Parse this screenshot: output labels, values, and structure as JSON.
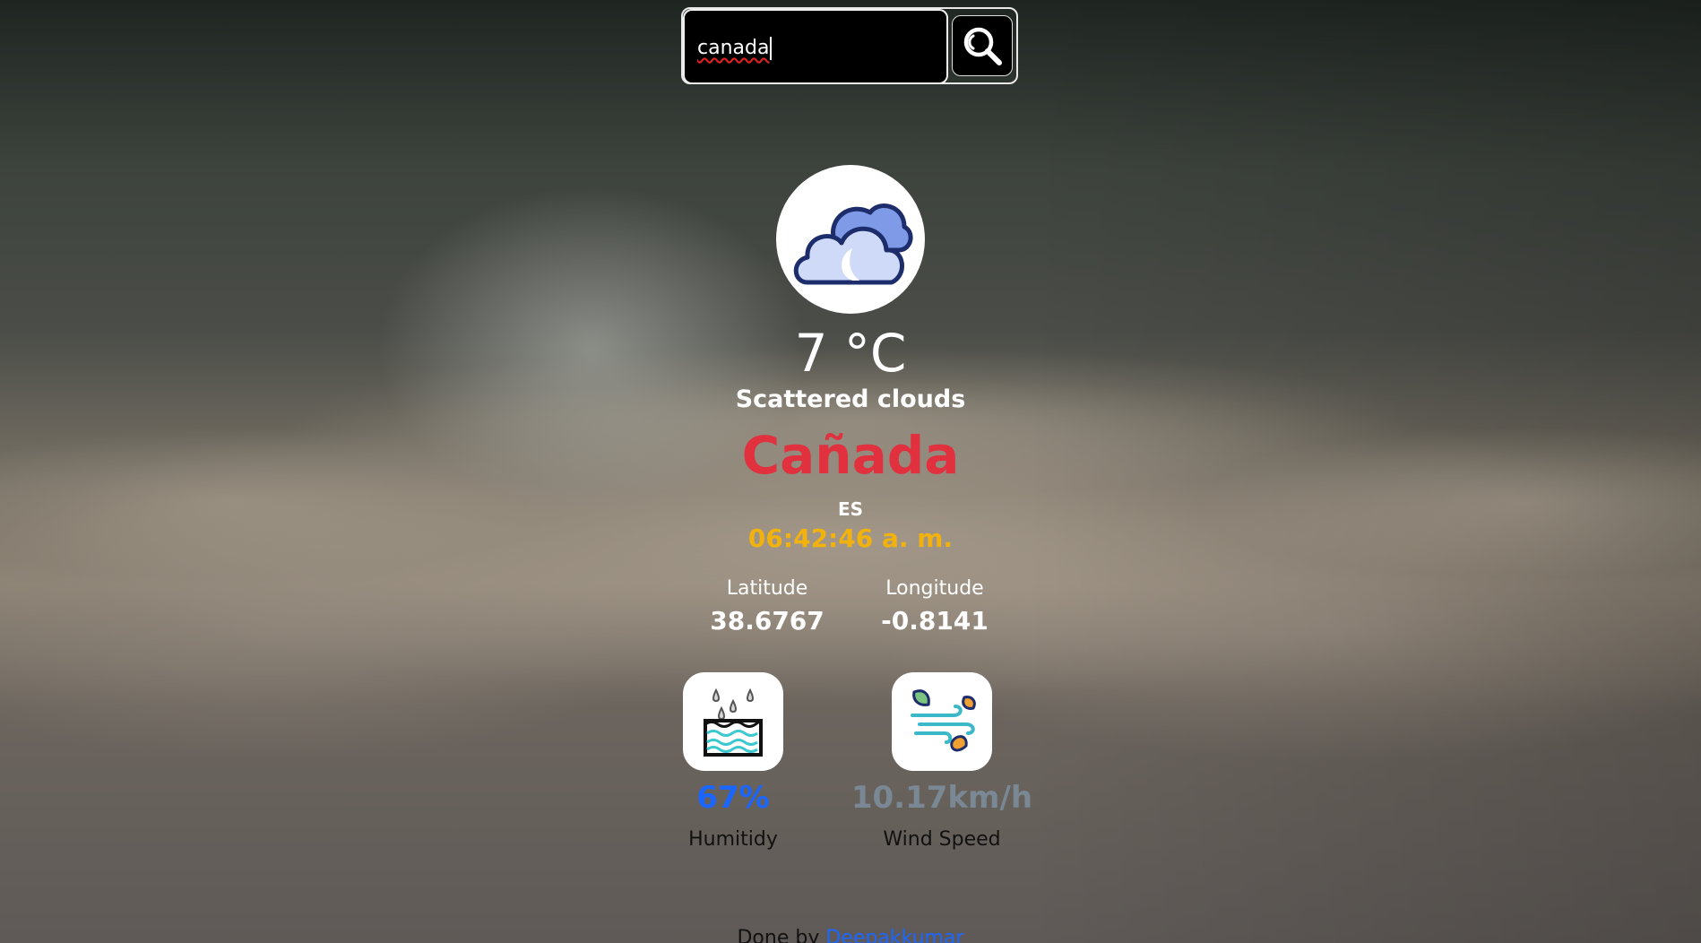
{
  "search": {
    "value": "canada"
  },
  "weather": {
    "icon": "partly-cloudy-icon",
    "temperature": "7 °C",
    "description": "Scattered clouds",
    "city": "Cañada",
    "country": "ES",
    "time": "06:42:46 a. m."
  },
  "coordinates": {
    "latitude_label": "Latitude",
    "latitude_value": "38.6767",
    "longitude_label": "Longitude",
    "longitude_value": "-0.8141"
  },
  "stats": {
    "humidity": {
      "icon": "humidity-icon",
      "value": "67%",
      "label": "Humitidy",
      "color": "#1a66ff"
    },
    "wind": {
      "icon": "wind-icon",
      "value": "10.17km/h",
      "label": "Wind Speed",
      "color": "#7a8794"
    }
  },
  "footer": {
    "prefix": "Done by",
    "author": "Deepakkumar"
  },
  "colors": {
    "city": "#e1313f",
    "time": "#f2b20d",
    "link": "#1a66ff"
  }
}
